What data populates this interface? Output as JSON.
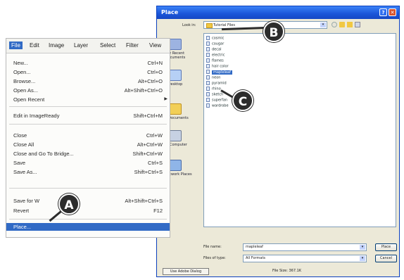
{
  "dialog": {
    "title": "Place",
    "look_in_label": "Look in:",
    "look_in_value": "Tutorial Files",
    "places": [
      {
        "label": "My Recent Documents",
        "icon": "recent-documents-icon"
      },
      {
        "label": "Desktop",
        "icon": "desktop-icon"
      },
      {
        "label": "My Documents",
        "icon": "my-documents-icon"
      },
      {
        "label": "My Computer",
        "icon": "my-computer-icon"
      },
      {
        "label": "My Network Places",
        "icon": "network-places-icon"
      }
    ],
    "files": [
      "cosmic",
      "cougar",
      "decal",
      "electric",
      "flames",
      "hair color",
      "mapleleaf",
      "neon",
      "pyramid",
      "rhino",
      "sketch",
      "superfan",
      "wardrobe"
    ],
    "selected_file": "mapleleaf",
    "file_name_label": "File name:",
    "file_name_value": "mapleleaf",
    "files_of_type_label": "Files of type:",
    "files_of_type_value": "All Formats",
    "open_button": "Place",
    "cancel_button": "Cancel",
    "use_adobe_dialog_button": "Use Adobe Dialog",
    "file_size": "File Size: 367.1K"
  },
  "menubar": {
    "items": [
      "File",
      "Edit",
      "Image",
      "Layer",
      "Select",
      "Filter",
      "View"
    ],
    "active": "File"
  },
  "file_menu": {
    "groups": [
      [
        {
          "label": "New...",
          "shortcut": "Ctrl+N"
        },
        {
          "label": "Open...",
          "shortcut": "Ctrl+O"
        },
        {
          "label": "Browse...",
          "shortcut": "Alt+Ctrl+O"
        },
        {
          "label": "Open As...",
          "shortcut": "Alt+Shift+Ctrl+O"
        },
        {
          "label": "Open Recent",
          "shortcut": "",
          "submenu": true
        }
      ],
      [
        {
          "label": "Edit in ImageReady",
          "shortcut": "Shift+Ctrl+M"
        }
      ],
      [
        {
          "label": "Close",
          "shortcut": "Ctrl+W"
        },
        {
          "label": "Close All",
          "shortcut": "Alt+Ctrl+W"
        },
        {
          "label": "Close and Go To Bridge...",
          "shortcut": "Shift+Ctrl+W"
        },
        {
          "label": "Save",
          "shortcut": "Ctrl+S"
        },
        {
          "label": "Save As...",
          "shortcut": "Shift+Ctrl+S"
        }
      ],
      [
        {
          "label": "Save for W",
          "shortcut": "Alt+Shift+Ctrl+S"
        },
        {
          "label": "Revert",
          "shortcut": "F12"
        }
      ],
      [
        {
          "label": "Place...",
          "shortcut": "",
          "highlighted": true
        }
      ]
    ]
  },
  "callouts": {
    "a": "A",
    "b": "B",
    "c": "C"
  }
}
